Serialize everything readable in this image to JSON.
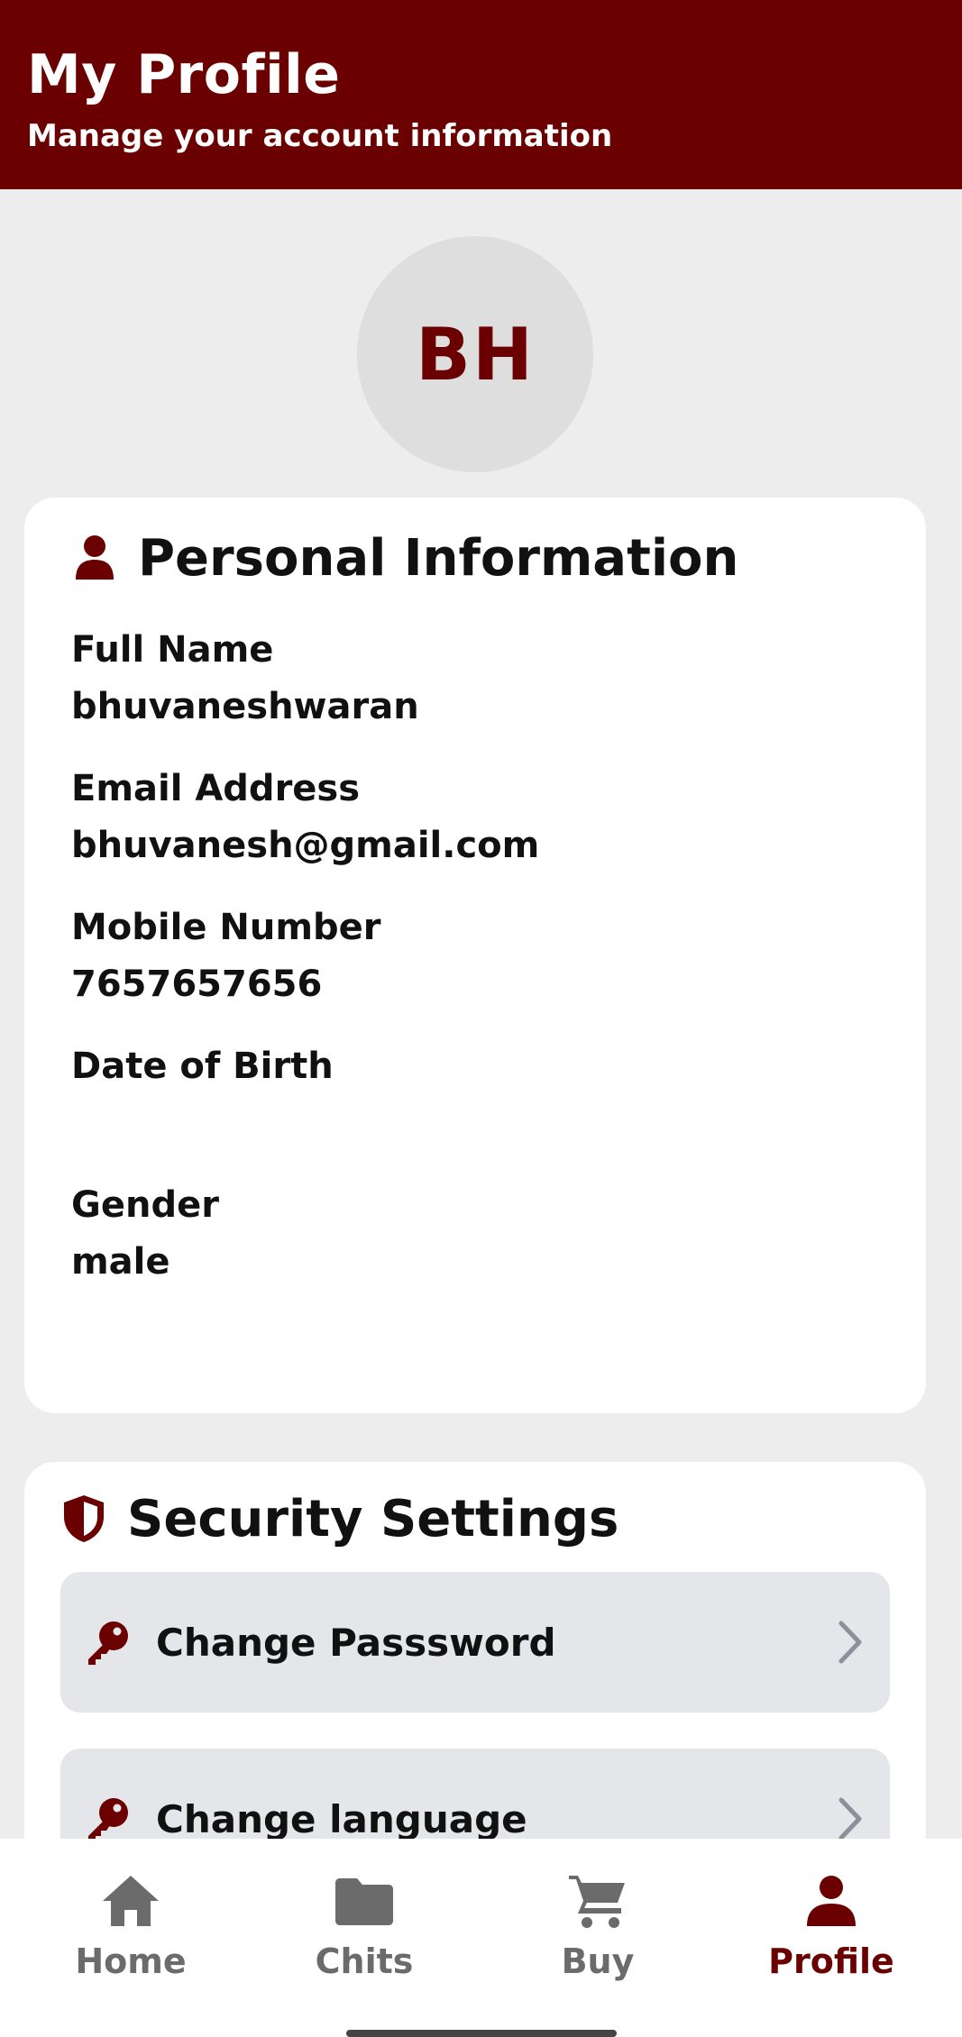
{
  "header": {
    "title": "My Profile",
    "subtitle": "Manage your account information"
  },
  "avatar": {
    "initials": "BH"
  },
  "personal": {
    "title": "Personal Information",
    "fields": [
      {
        "label": "Full Name",
        "value": "bhuvaneshwaran"
      },
      {
        "label": "Email Address",
        "value": "bhuvanesh@gmail.com"
      },
      {
        "label": "Mobile Number",
        "value": "7657657656"
      },
      {
        "label": "Date of Birth",
        "value": ""
      },
      {
        "label": "Gender",
        "value": "male"
      }
    ]
  },
  "security": {
    "title": "Security Settings",
    "items": [
      {
        "label": "Change Passsword",
        "icon": "key-icon"
      },
      {
        "label": "Change language",
        "icon": "key-icon"
      }
    ]
  },
  "nav": {
    "items": [
      {
        "label": "Home",
        "icon": "home-icon",
        "active": false
      },
      {
        "label": "Chits",
        "icon": "folder-icon",
        "active": false
      },
      {
        "label": "Buy",
        "icon": "cart-icon",
        "active": false
      },
      {
        "label": "Profile",
        "icon": "person-icon",
        "active": true
      }
    ]
  },
  "colors": {
    "brand": "#6b0000",
    "background": "#ededed",
    "inactive": "#6b6b6b",
    "row_bg": "#e5e6ea"
  }
}
